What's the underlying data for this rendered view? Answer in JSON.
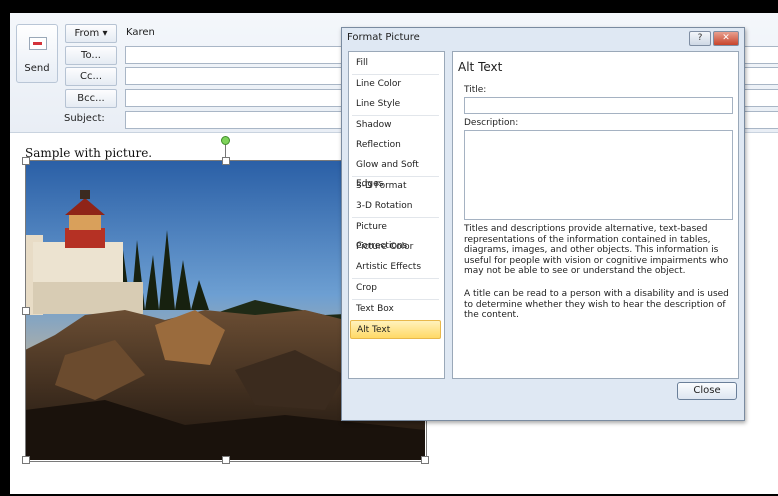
{
  "header": {
    "send_label": "Send",
    "from_label": "From ▾",
    "from_value": "Karen",
    "to_label": "To...",
    "cc_label": "Cc...",
    "bcc_label": "Bcc...",
    "subject_label": "Subject:"
  },
  "body": {
    "text": "Sample with picture."
  },
  "dialog": {
    "title": "Format Picture",
    "help_label": "?",
    "close_x": "✕",
    "categories": [
      "Fill",
      "Line Color",
      "Line Style",
      "Shadow",
      "Reflection",
      "Glow and Soft Edges",
      "3-D Format",
      "3-D Rotation",
      "Picture Corrections",
      "Picture Color",
      "Artistic Effects",
      "Crop",
      "Text Box",
      "Alt Text"
    ],
    "selected_category": "Alt Text",
    "panel": {
      "heading": "Alt Text",
      "title_label": "Title:",
      "title_value": "",
      "description_label": "Description:",
      "description_value": "",
      "info1": "Titles and descriptions provide alternative, text-based representations of the information contained in tables, diagrams, images, and other objects. This information is useful for people with vision or cognitive impairments who may not be able to see or understand the object.",
      "info2": "A title can be read to a person with a disability and is used to determine whether they wish to hear the description of the content."
    },
    "close_button": "Close"
  }
}
